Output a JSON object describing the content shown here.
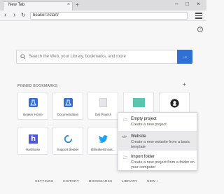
{
  "tab": {
    "title": "New Tab",
    "close": "×",
    "new_tab": "+"
  },
  "window": {
    "minimize": "–",
    "maximize": "□",
    "close": "×"
  },
  "nav": {
    "back": "‹",
    "forward": "›",
    "reload": "↻",
    "url": "beaker://start/"
  },
  "search": {
    "placeholder": "Search the Web, your Library, bookmarks, and more",
    "go": "→"
  },
  "pinned": {
    "label": "PINNED BOOKMARKS",
    "add": "+",
    "items": [
      {
        "label": "Beaker Home"
      },
      {
        "label": "Documentation"
      },
      {
        "label": "Dat Project"
      },
      {
        "label": ""
      },
      {
        "label": ""
      },
      {
        "label": "Hashbase"
      },
      {
        "label": "Support Beaker"
      },
      {
        "label": "@BeakerBrows..."
      }
    ]
  },
  "hashbase_letter": "h",
  "dropdown": {
    "items": [
      {
        "icon": "🗀",
        "title": "Empty project",
        "desc": "Create a new project"
      },
      {
        "icon": "</>",
        "title": "Website",
        "desc": "Create a new website from a basic template"
      },
      {
        "icon": "🗀",
        "title": "Import folder",
        "desc": "Create a new project from a folder on your computer"
      }
    ]
  },
  "footer": {
    "settings": "SETTINGS",
    "history": "HISTORY",
    "bookmarks": "BOOKMARKS",
    "library": "LIBRARY",
    "new": "NEW +"
  },
  "colors": {
    "accent": "#2f6fd6",
    "teal": "#5bc6b0",
    "hashbase": "#4e57d6",
    "twitter": "#1da1f2"
  }
}
